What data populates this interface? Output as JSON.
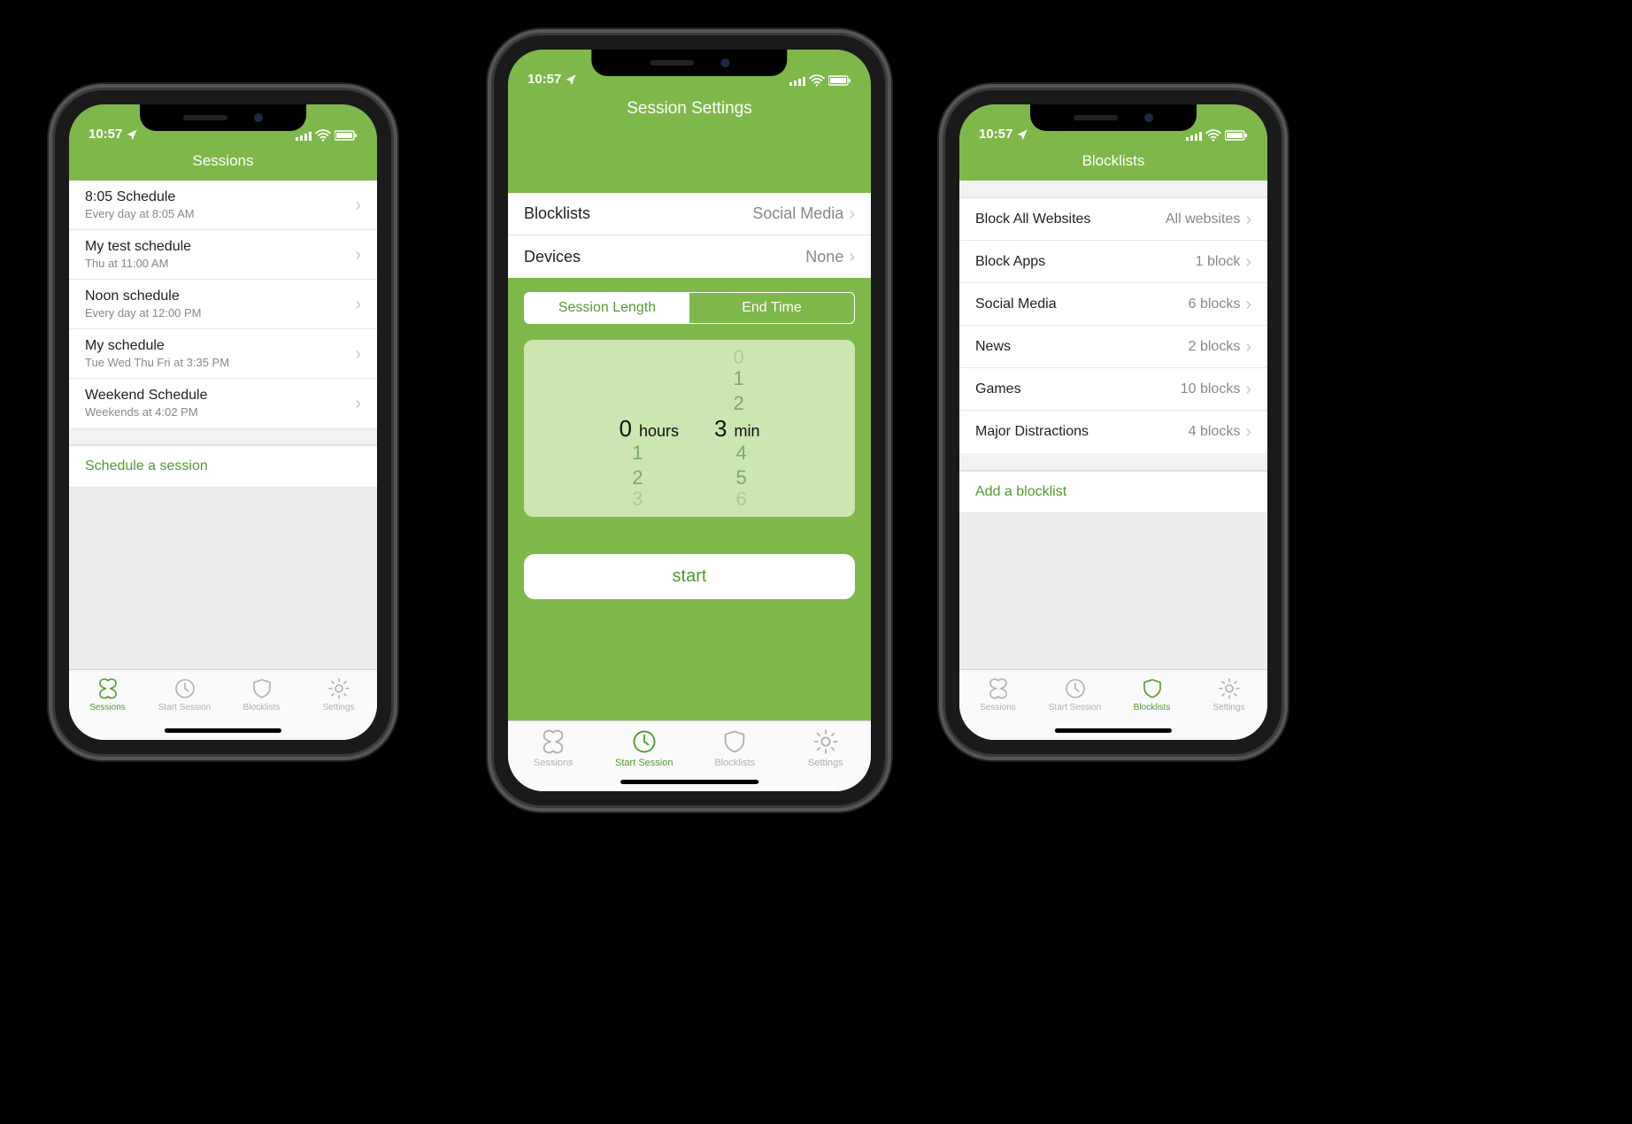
{
  "status": {
    "time": "10:57"
  },
  "tabs": {
    "sessions": "Sessions",
    "start_session": "Start Session",
    "blocklists": "Blocklists",
    "settings": "Settings"
  },
  "left": {
    "title": "Sessions",
    "items": [
      {
        "title": "8:05 Schedule",
        "sub": "Every day at 8:05 AM"
      },
      {
        "title": "My test schedule",
        "sub": "Thu at 11:00 AM"
      },
      {
        "title": "Noon schedule",
        "sub": "Every day at 12:00 PM"
      },
      {
        "title": "My schedule",
        "sub": "Tue Wed Thu Fri at 3:35 PM"
      },
      {
        "title": "Weekend Schedule",
        "sub": "Weekends at 4:02 PM"
      }
    ],
    "action": "Schedule a session",
    "active_tab": "sessions"
  },
  "mid": {
    "title": "Session Settings",
    "rows": {
      "blocklists_label": "Blocklists",
      "blocklists_value": "Social Media",
      "devices_label": "Devices",
      "devices_value": "None"
    },
    "segments": {
      "length": "Session Length",
      "end": "End Time"
    },
    "picker": {
      "hours_value": "0",
      "hours_unit": "hours",
      "min_value": "3",
      "min_unit": "min",
      "above": [
        "1",
        "2"
      ],
      "below": [
        "4",
        "5"
      ],
      "h_below": [
        "1",
        "2"
      ]
    },
    "start": "start",
    "active_tab": "start_session"
  },
  "right": {
    "title": "Blocklists",
    "items": [
      {
        "title": "Block All Websites",
        "value": "All websites"
      },
      {
        "title": "Block Apps",
        "value": "1 block"
      },
      {
        "title": "Social Media",
        "value": "6 blocks"
      },
      {
        "title": "News",
        "value": "2 blocks"
      },
      {
        "title": "Games",
        "value": "10 blocks"
      },
      {
        "title": "Major Distractions",
        "value": "4 blocks"
      }
    ],
    "action": "Add a blocklist",
    "active_tab": "blocklists"
  }
}
